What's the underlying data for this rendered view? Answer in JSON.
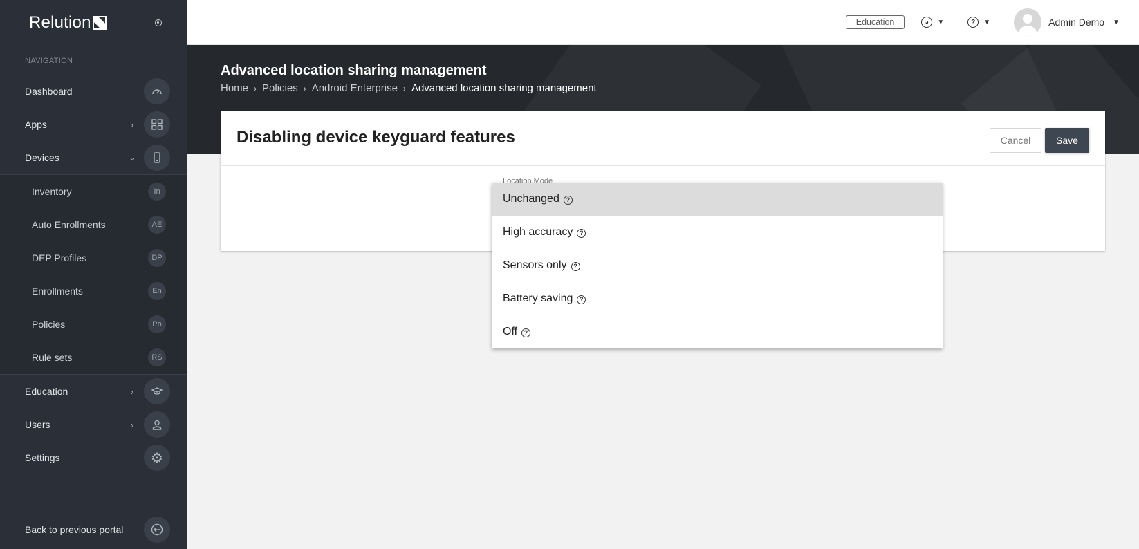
{
  "sidebar": {
    "brand": "Relution",
    "heading": "NAVIGATION",
    "items": [
      {
        "label": "Dashboard"
      },
      {
        "label": "Apps"
      },
      {
        "label": "Devices"
      }
    ],
    "device_sub": [
      {
        "label": "Inventory",
        "abbr": "In"
      },
      {
        "label": "Auto Enrollments",
        "abbr": "AE"
      },
      {
        "label": "DEP Profiles",
        "abbr": "DP"
      },
      {
        "label": "Enrollments",
        "abbr": "En"
      },
      {
        "label": "Policies",
        "abbr": "Po"
      },
      {
        "label": "Rule sets",
        "abbr": "RS"
      }
    ],
    "items_after": [
      {
        "label": "Education"
      },
      {
        "label": "Users"
      },
      {
        "label": "Settings"
      }
    ],
    "back": "Back to previous portal"
  },
  "topbar": {
    "badge": "Education",
    "user": "Admin Demo"
  },
  "hero": {
    "title": "Advanced location sharing management",
    "breadcrumb": [
      "Home",
      "Policies",
      "Android Enterprise",
      "Advanced location sharing management"
    ]
  },
  "card": {
    "title": "Disabling device keyguard features",
    "cancel": "Cancel",
    "save": "Save",
    "field_label": "Location Mode"
  },
  "dropdown": {
    "options": [
      "Unchanged",
      "High accuracy",
      "Sensors only",
      "Battery saving",
      "Off"
    ],
    "selected": "Unchanged"
  }
}
